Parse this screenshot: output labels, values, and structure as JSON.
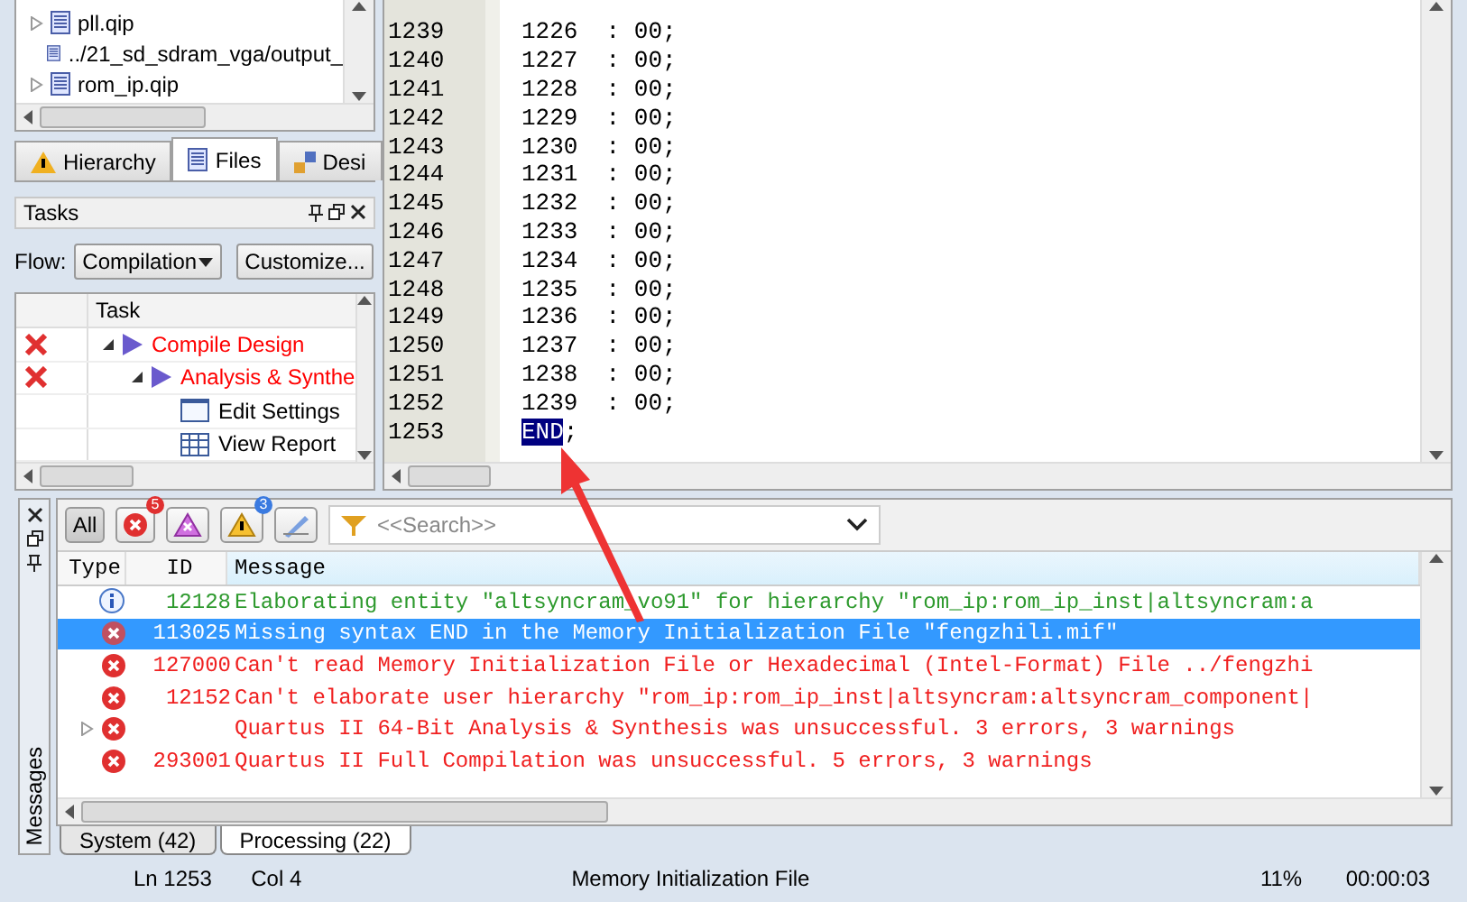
{
  "files": [
    {
      "name": "pll.qip",
      "expandable": true
    },
    {
      "name": "../21_sd_sdram_vga/output_",
      "expandable": false
    },
    {
      "name": "rom_ip.qip",
      "expandable": true
    }
  ],
  "left_tabs": [
    {
      "label": "Hierarchy",
      "kind": "warning",
      "selected": false
    },
    {
      "label": "Files",
      "kind": "file",
      "selected": true
    },
    {
      "label": "Desi",
      "kind": "design",
      "selected": false
    }
  ],
  "tasks": {
    "title": "Tasks",
    "flow_label": "Flow:",
    "flow": "Compilation",
    "customize": "Customize...",
    "column": "Task",
    "items": [
      {
        "label": "Compile Design",
        "failed": true,
        "expanded": true,
        "kind": "run",
        "children": [
          {
            "label": "Analysis & Synthe",
            "failed": true,
            "expanded": true,
            "kind": "run",
            "children": [
              {
                "label": "Edit Settings",
                "failed": false,
                "kind": "settings"
              },
              {
                "label": "View Report",
                "failed": false,
                "kind": "report"
              }
            ]
          }
        ]
      }
    ]
  },
  "editor": {
    "lines": [
      {
        "number": "1239",
        "text": "1226  : 00;"
      },
      {
        "number": "1240",
        "text": "1227  : 00;"
      },
      {
        "number": "1241",
        "text": "1228  : 00;"
      },
      {
        "number": "1242",
        "text": "1229  : 00;"
      },
      {
        "number": "1243",
        "text": "1230  : 00;"
      },
      {
        "number": "1244",
        "text": "1231  : 00;"
      },
      {
        "number": "1245",
        "text": "1232  : 00;"
      },
      {
        "number": "1246",
        "text": "1233  : 00;"
      },
      {
        "number": "1247",
        "text": "1234  : 00;"
      },
      {
        "number": "1248",
        "text": "1235  : 00;"
      },
      {
        "number": "1249",
        "text": "1236  : 00;"
      },
      {
        "number": "1250",
        "text": "1237  : 00;"
      },
      {
        "number": "1251",
        "text": "1238  : 00;"
      },
      {
        "number": "1252",
        "text": "1239  : 00;"
      },
      {
        "number": "1253",
        "selection": "END",
        "text": ";"
      }
    ]
  },
  "messages": {
    "panel_title": "Messages",
    "search_placeholder": "<<Search>>",
    "filters": [
      {
        "kind": "all",
        "label": "All",
        "selected": true
      },
      {
        "kind": "error",
        "count": "5",
        "selected": false
      },
      {
        "kind": "critical",
        "selected": false
      },
      {
        "kind": "warning",
        "count": "3",
        "selected": false
      },
      {
        "kind": "suppressed",
        "selected": false
      }
    ],
    "columns": [
      "Type",
      "ID",
      "Message"
    ],
    "rows": [
      {
        "kind": "info",
        "id": "12128",
        "text": "Elaborating entity \"altsyncram_vo91\" for hierarchy \"rom_ip:rom_ip_inst|altsyncram:a",
        "selected": false,
        "expandable": false
      },
      {
        "kind": "error",
        "id": "113025",
        "text": "Missing syntax END in the Memory Initialization File \"fengzhili.mif\"",
        "selected": true,
        "expandable": false
      },
      {
        "kind": "error",
        "id": "127000",
        "text": "Can't read Memory Initialization File or Hexadecimal (Intel-Format) File ../fengzhi",
        "selected": false,
        "expandable": false
      },
      {
        "kind": "error",
        "id": "12152",
        "text": "Can't elaborate user hierarchy \"rom_ip:rom_ip_inst|altsyncram:altsyncram_component|",
        "selected": false,
        "expandable": false
      },
      {
        "kind": "error",
        "text": "Quartus II 64-Bit Analysis & Synthesis was unsuccessful. 3 errors, 3 warnings",
        "selected": false,
        "expandable": true
      },
      {
        "kind": "error",
        "id": "293001",
        "text": "Quartus II Full Compilation was unsuccessful. 5 errors, 3 warnings",
        "selected": false,
        "expandable": false
      }
    ],
    "tabs": [
      {
        "label": "System (42)",
        "selected": false
      },
      {
        "label": "Processing (22)",
        "selected": true
      }
    ]
  },
  "status_bar": {
    "line": "Ln 1253",
    "column": "Col 4",
    "file_type": "Memory Initialization File",
    "progress": "11%",
    "elapsed": "00:00:03"
  }
}
